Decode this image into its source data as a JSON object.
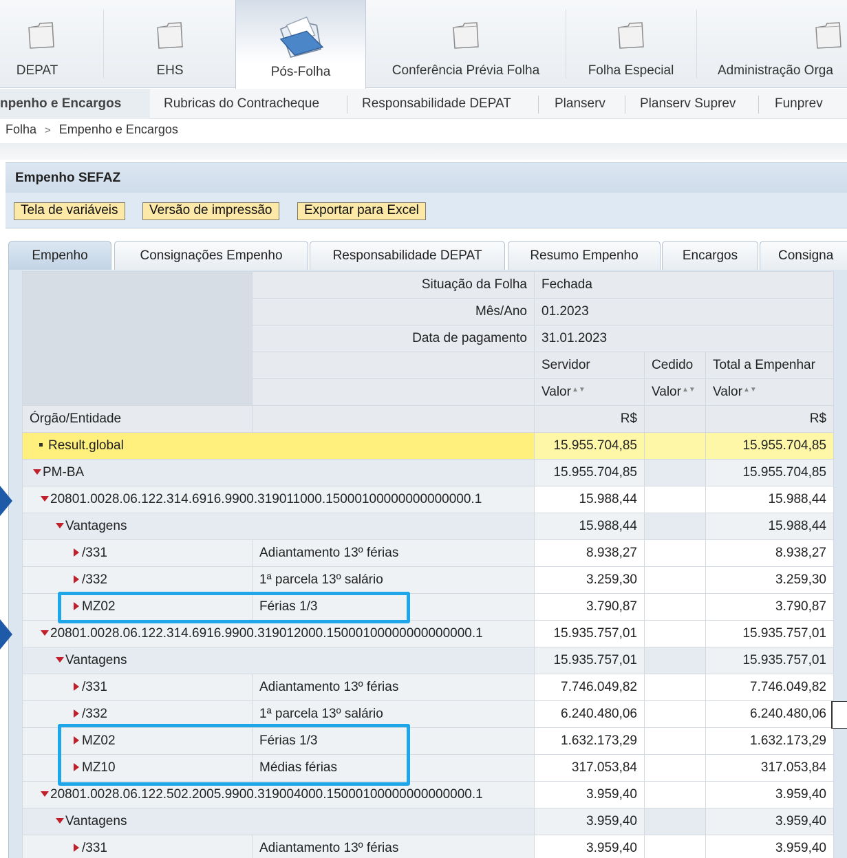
{
  "workset": {
    "items": [
      {
        "label": "DEPAT"
      },
      {
        "label": "EHS"
      },
      {
        "label": "Pós-Folha"
      },
      {
        "label": "Conferência Prévia Folha"
      },
      {
        "label": "Folha Especial"
      },
      {
        "label": "Administração Orga"
      }
    ],
    "active_index": 2
  },
  "subnav": {
    "items": [
      {
        "label": "npenho e Encargos"
      },
      {
        "label": "Rubricas do Contracheque"
      },
      {
        "label": "Responsabilidade DEPAT"
      },
      {
        "label": "Planserv"
      },
      {
        "label": "Planserv Suprev"
      },
      {
        "label": "Funprev"
      }
    ]
  },
  "breadcrumb": {
    "root": "Folha",
    "separator": ">",
    "current": "Empenho e Encargos"
  },
  "panel": {
    "title": "Empenho SEFAZ"
  },
  "toolbar": {
    "variables": "Tela de variáveis",
    "print": "Versão de impressão",
    "excel": "Exportar para Excel"
  },
  "tabs": [
    {
      "label": "Empenho"
    },
    {
      "label": "Consignações Empenho"
    },
    {
      "label": "Responsabilidade DEPAT"
    },
    {
      "label": "Resumo Empenho"
    },
    {
      "label": "Encargos"
    },
    {
      "label": "Consigna"
    }
  ],
  "report_header": {
    "situacao_label": "Situação da Folha",
    "situacao_value": "Fechada",
    "mesano_label": "Mês/Ano",
    "mesano_value": "01.2023",
    "datapag_label": "Data de pagamento",
    "datapag_value": "31.01.2023",
    "col_servidor": "Servidor",
    "col_cedido": "Cedido",
    "col_total": "Total a Empenhar",
    "valor": "Valor",
    "orgao_label": "Órgão/Entidade",
    "currency": "R$"
  },
  "rows": {
    "result": {
      "label": "Result.global",
      "servidor": "15.955.704,85",
      "total": "15.955.704,85"
    },
    "pmba": {
      "label": "PM-BA",
      "servidor": "15.955.704,85",
      "total": "15.955.704,85"
    },
    "acc1": {
      "label": "20801.0028.06.122.314.6916.9900.319011000.15000100000000000000.1",
      "servidor": "15.988,44",
      "total": "15.988,44"
    },
    "vant1": {
      "label": "Vantagens",
      "servidor": "15.988,44",
      "total": "15.988,44"
    },
    "a1_331": {
      "code": "/331",
      "desc": "Adiantamento 13º férias",
      "servidor": "8.938,27",
      "total": "8.938,27"
    },
    "a1_332": {
      "code": "/332",
      "desc": "1ª parcela 13º salário",
      "servidor": "3.259,30",
      "total": "3.259,30"
    },
    "a1_mz02": {
      "code": "MZ02",
      "desc": "Férias 1/3",
      "servidor": "3.790,87",
      "total": "3.790,87"
    },
    "acc2": {
      "label": "20801.0028.06.122.314.6916.9900.319012000.15000100000000000000.1",
      "servidor": "15.935.757,01",
      "total": "15.935.757,01"
    },
    "vant2": {
      "label": "Vantagens",
      "servidor": "15.935.757,01",
      "total": "15.935.757,01"
    },
    "a2_331": {
      "code": "/331",
      "desc": "Adiantamento 13º férias",
      "servidor": "7.746.049,82",
      "total": "7.746.049,82"
    },
    "a2_332": {
      "code": "/332",
      "desc": "1ª parcela 13º salário",
      "servidor": "6.240.480,06",
      "total": "6.240.480,06"
    },
    "a2_mz02": {
      "code": "MZ02",
      "desc": "Férias 1/3",
      "servidor": "1.632.173,29",
      "total": "1.632.173,29"
    },
    "a2_mz10": {
      "code": "MZ10",
      "desc": "Médias férias",
      "servidor": "317.053,84",
      "total": "317.053,84"
    },
    "acc3": {
      "label": "20801.0028.06.122.502.2005.9900.319004000.15000100000000000000.1",
      "servidor": "3.959,40",
      "total": "3.959,40"
    },
    "vant3": {
      "label": "Vantagens",
      "servidor": "3.959,40",
      "total": "3.959,40"
    },
    "a3_331": {
      "code": "/331",
      "desc": "Adiantamento 13º férias",
      "servidor": "3.959,40",
      "total": "3.959,40"
    }
  },
  "colors": {
    "highlight": "#1ea7e8",
    "arrow": "#1e5aa8",
    "result_bg": "#fff7a8",
    "expand_marker": "#c0202a",
    "button_bg": "#fde9a7"
  }
}
